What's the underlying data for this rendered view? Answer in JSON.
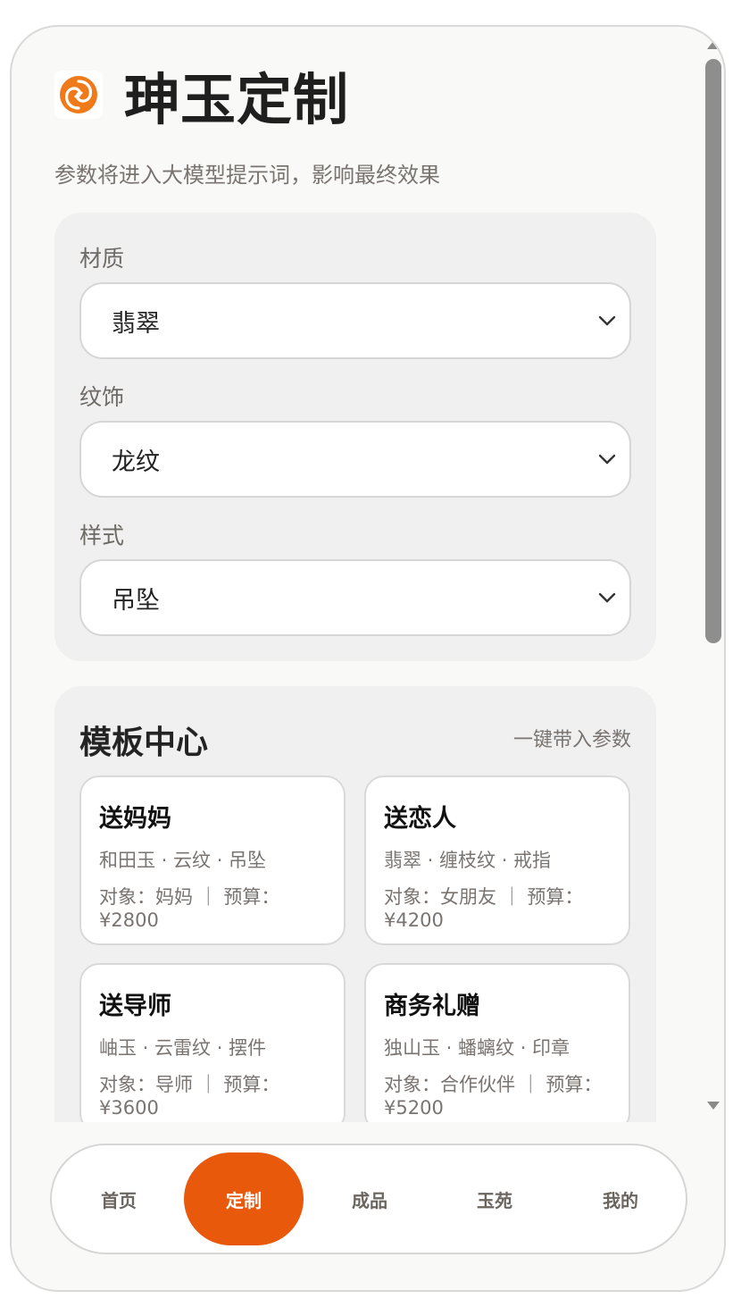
{
  "app": {
    "title": "珅玉定制",
    "subtitle": "参数将进入大模型提示词，影响最终效果"
  },
  "params": {
    "material": {
      "label": "材质",
      "value": "翡翠"
    },
    "pattern": {
      "label": "纹饰",
      "value": "龙纹"
    },
    "style": {
      "label": "样式",
      "value": "吊坠"
    }
  },
  "templates": {
    "title": "模板中心",
    "hint": "一键带入参数",
    "items": [
      {
        "title": "送妈妈",
        "spec": "和田玉 · 云纹 · 吊坠",
        "target": "对象：妈妈",
        "budget": "预算：¥2800"
      },
      {
        "title": "送恋人",
        "spec": "翡翠 · 缠枝纹 · 戒指",
        "target": "对象：女朋友",
        "budget": "预算：¥4200"
      },
      {
        "title": "送导师",
        "spec": "岫玉 · 云雷纹 · 摆件",
        "target": "对象：导师",
        "budget": "预算：¥3600"
      },
      {
        "title": "商务礼赠",
        "spec": "独山玉 · 蟠螭纹 · 印章",
        "target": "对象：合作伙伴",
        "budget": "预算：¥5200"
      }
    ]
  },
  "separator": "｜",
  "tabs": [
    {
      "label": "首页"
    },
    {
      "label": "定制"
    },
    {
      "label": "成品"
    },
    {
      "label": "玉苑"
    },
    {
      "label": "我的"
    }
  ],
  "colors": {
    "accent": "#e8590c",
    "background": "#f9f9f7",
    "panel": "#f0f0f0",
    "muted_text": "#7a7470"
  },
  "icons": {
    "logo": "swirl-logo-icon",
    "dropdown": "chevron-down-icon"
  }
}
